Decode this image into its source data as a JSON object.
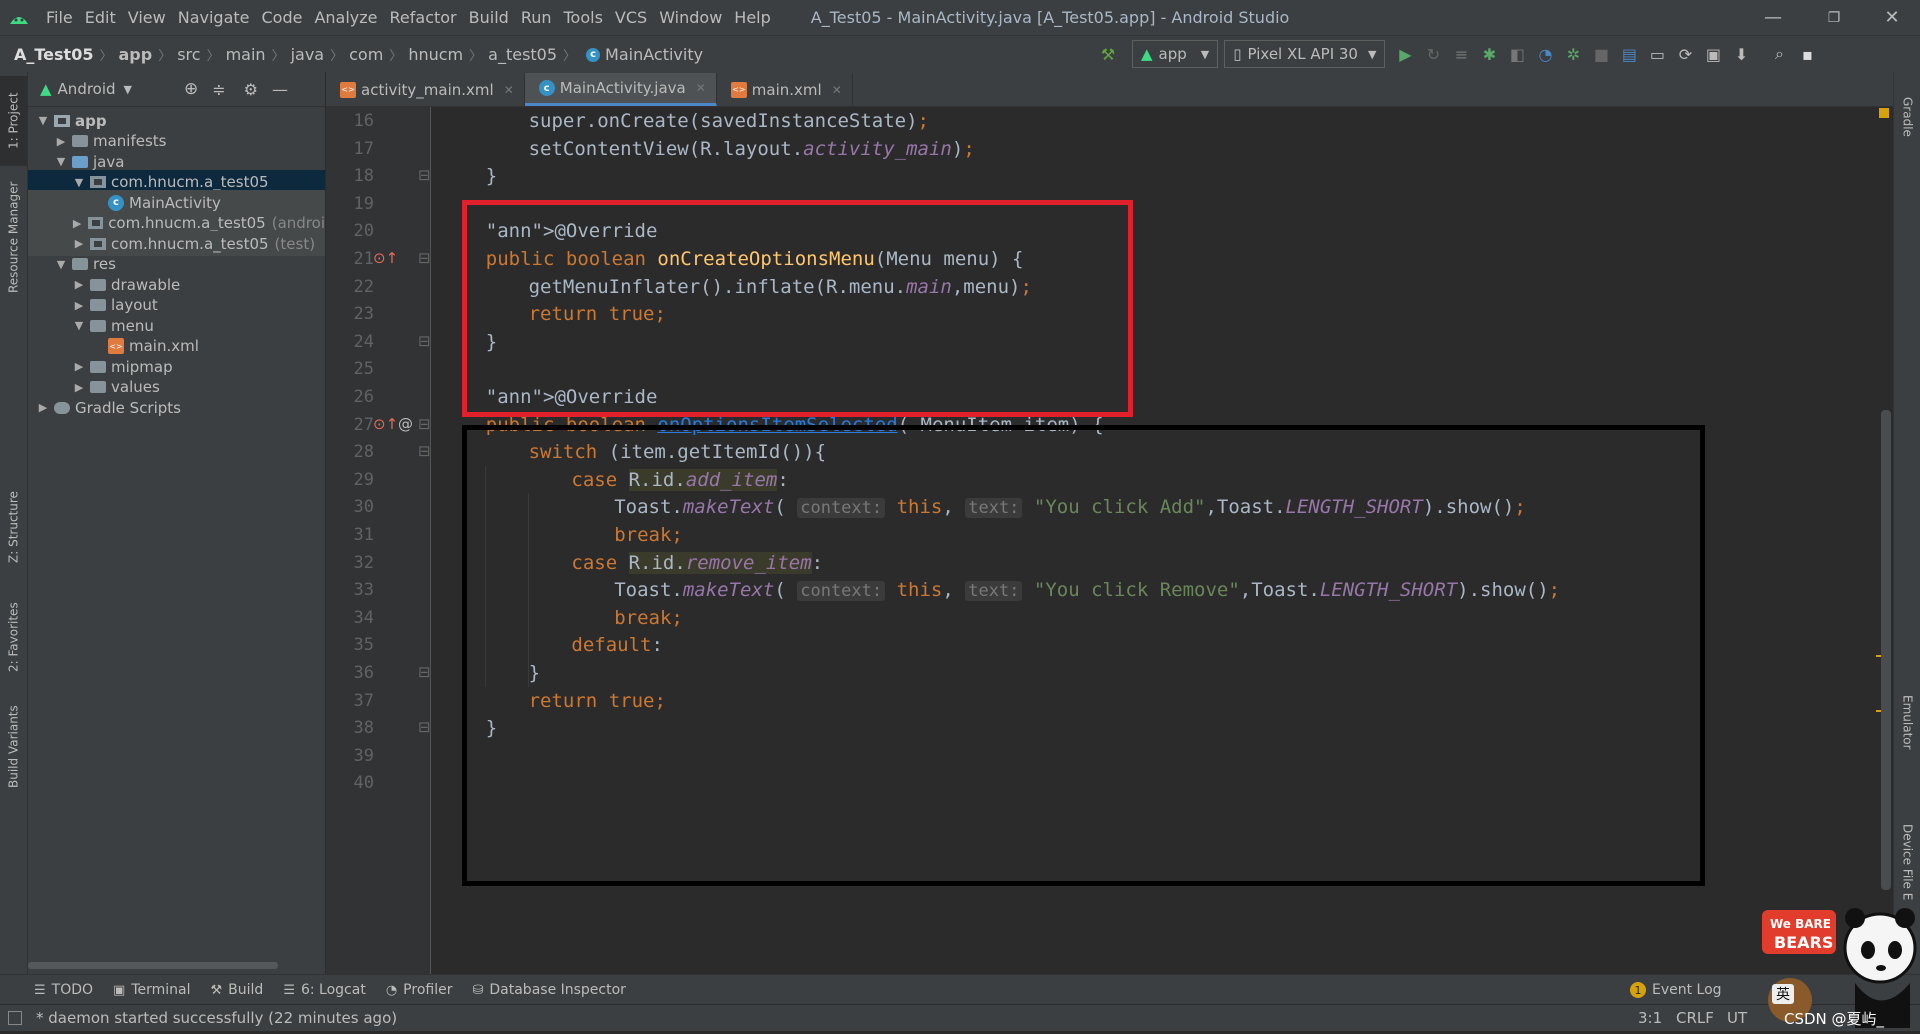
{
  "window": {
    "menu": [
      "File",
      "Edit",
      "View",
      "Navigate",
      "Code",
      "Analyze",
      "Refactor",
      "Build",
      "Run",
      "Tools",
      "VCS",
      "Window",
      "Help"
    ],
    "title": "A_Test05 - MainActivity.java [A_Test05.app] - Android Studio"
  },
  "breadcrumb": [
    "A_Test05",
    "app",
    "src",
    "main",
    "java",
    "com",
    "hnucm",
    "a_test05",
    "MainActivity"
  ],
  "toolbar": {
    "run_config": "app",
    "device": "Pixel XL API 30"
  },
  "left_stripe": {
    "project": "1: Project",
    "resource_manager": "Resource Manager",
    "structure": "Z: Structure",
    "favorites": "2: Favorites",
    "build_variants": "Build Variants"
  },
  "right_stripe": {
    "gradle": "Gradle",
    "emulator": "Emulator",
    "device_file": "Device File E"
  },
  "project_panel": {
    "view_mode": "Android",
    "tree": [
      {
        "label": "app",
        "level": 0,
        "expanded": true,
        "icon": "module"
      },
      {
        "label": "manifests",
        "level": 1,
        "expanded": false,
        "icon": "folder"
      },
      {
        "label": "java",
        "level": 1,
        "expanded": true,
        "icon": "folder-blue"
      },
      {
        "label": "com.hnucm.a_test05",
        "level": 2,
        "expanded": true,
        "icon": "package"
      },
      {
        "label": "MainActivity",
        "level": 3,
        "icon": "class"
      },
      {
        "label": "com.hnucm.a_test05",
        "suffix": "(androi",
        "level": 2,
        "expanded": false,
        "icon": "package"
      },
      {
        "label": "com.hnucm.a_test05",
        "suffix": "(test)",
        "level": 2,
        "expanded": false,
        "icon": "package"
      },
      {
        "label": "res",
        "level": 1,
        "expanded": true,
        "icon": "folder"
      },
      {
        "label": "drawable",
        "level": 2,
        "expanded": false,
        "icon": "folder"
      },
      {
        "label": "layout",
        "level": 2,
        "expanded": false,
        "icon": "folder"
      },
      {
        "label": "menu",
        "level": 2,
        "expanded": true,
        "icon": "folder"
      },
      {
        "label": "main.xml",
        "level": 3,
        "icon": "xml"
      },
      {
        "label": "mipmap",
        "level": 2,
        "expanded": false,
        "icon": "folder"
      },
      {
        "label": "values",
        "level": 2,
        "expanded": false,
        "icon": "folder"
      },
      {
        "label": "Gradle Scripts",
        "level": 0,
        "expanded": false,
        "icon": "gradle"
      }
    ]
  },
  "tabs": [
    {
      "label": "activity_main.xml",
      "icon": "xml",
      "active": false
    },
    {
      "label": "MainActivity.java",
      "icon": "class",
      "active": true
    },
    {
      "label": "main.xml",
      "icon": "xml",
      "active": false
    }
  ],
  "editor": {
    "line_numbers": [
      "16",
      "17",
      "18",
      "19",
      "20",
      "21",
      "22",
      "23",
      "24",
      "25",
      "26",
      "27",
      "28",
      "29",
      "30",
      "31",
      "32",
      "33",
      "34",
      "35",
      "36",
      "37",
      "38",
      "39",
      "40"
    ],
    "lines": [
      "super.onCreate(savedInstanceState);",
      "setContentView(R.layout.activity_main);",
      "}",
      "",
      "@Override",
      "public boolean onCreateOptionsMenu(Menu menu) {",
      "getMenuInflater().inflate(R.menu.main,menu);",
      "return true;",
      "}",
      "",
      "@Override",
      "public boolean onOptionsItemSelected( MenuItem item) {",
      "switch (item.getItemId()){",
      "case R.id.add_item:",
      "Toast.makeText( context: this, text: \"You click Add\",Toast.LENGTH_SHORT).show();",
      "break;",
      "case R.id.remove_item:",
      "Toast.makeText( context: this, text: \"You click Remove\",Toast.LENGTH_SHORT).show();",
      "break;",
      "default:",
      "}",
      "return true;",
      "}",
      "}",
      ""
    ]
  },
  "bottom_tabs": [
    "TODO",
    "Terminal",
    "Build",
    "6: Logcat",
    "Profiler",
    "Database Inspector"
  ],
  "event_log": {
    "count": "1",
    "label": "Event Log"
  },
  "status": {
    "message": "* daemon started successfully (22 minutes ago)",
    "position": "3:1",
    "line_sep": "CRLF",
    "encoding": "UT"
  },
  "watermark": {
    "badge": "英",
    "text": "CSDN @夏屿_"
  },
  "colors": {
    "annotation_red": "#e0202a",
    "annotation_black": "#000000",
    "accent": "#4a88c7"
  }
}
